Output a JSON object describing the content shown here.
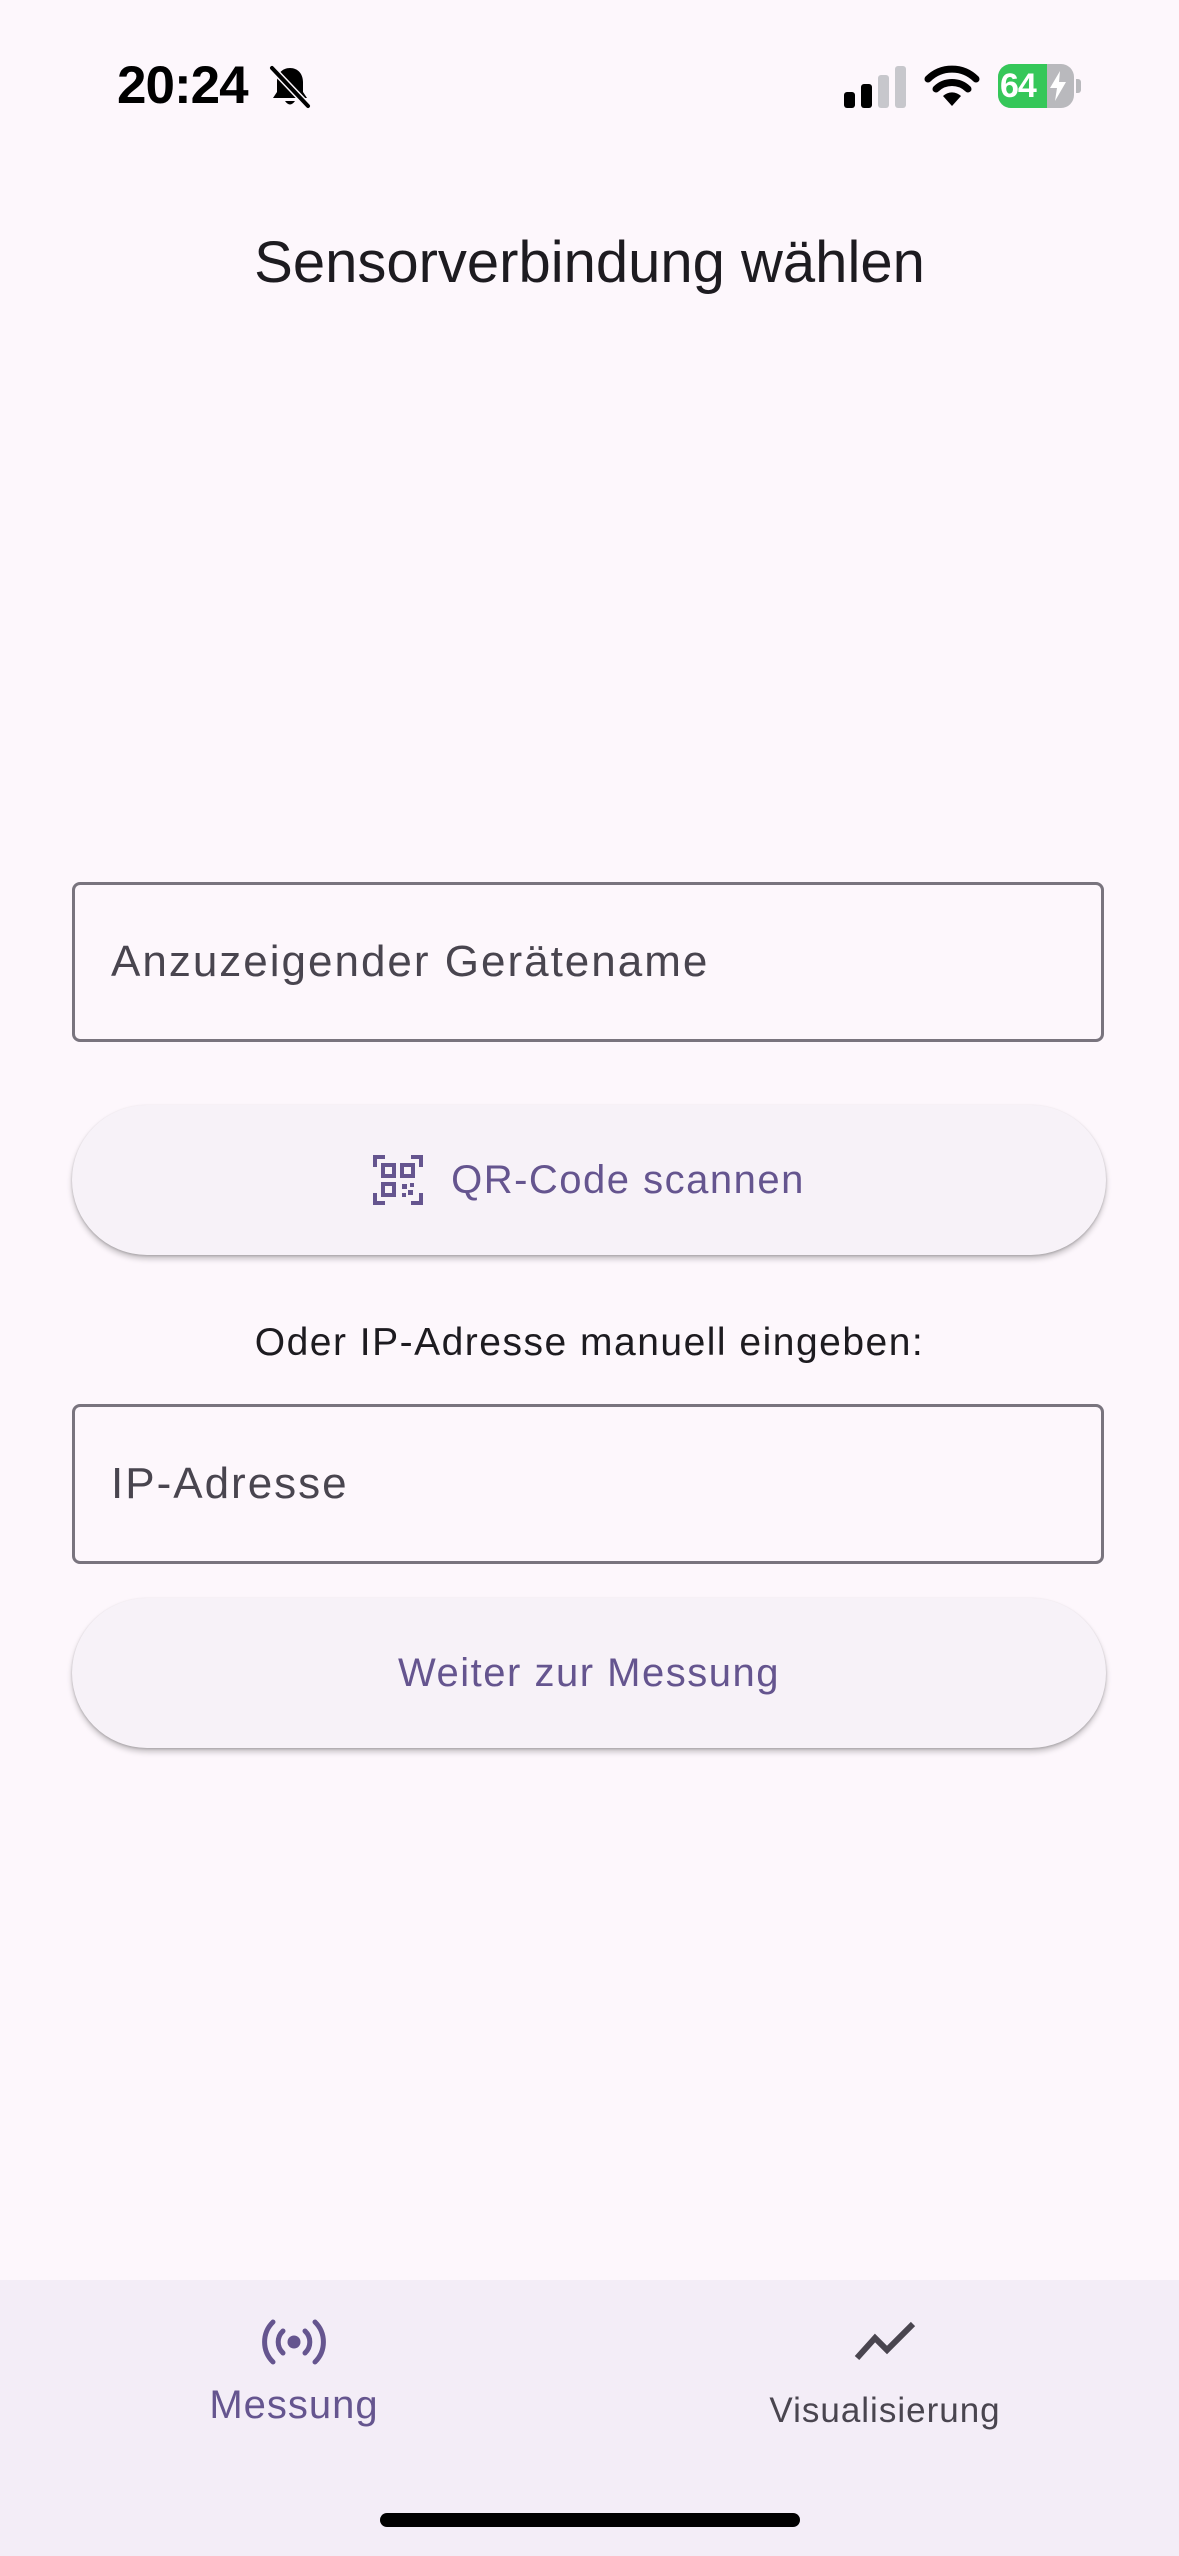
{
  "status_bar": {
    "time": "20:24",
    "battery_level": "64",
    "battery_fraction": 0.64,
    "icons": [
      "bell-slash-icon",
      "cellular-signal-icon",
      "wifi-icon",
      "battery-charging-icon"
    ]
  },
  "header": {
    "title": "Sensorverbindung wählen"
  },
  "form": {
    "device_name_placeholder": "Anzuzeigender Gerätename",
    "device_name_value": "",
    "qr_button_label": "QR-Code scannen",
    "qr_button_icon": "qr-code-scanner-icon",
    "or_text": "Oder IP-Adresse manuell eingeben:",
    "ip_placeholder": "IP-Adresse",
    "ip_value": "",
    "continue_button_label": "Weiter zur Messung"
  },
  "bottom_nav": {
    "items": [
      {
        "label": "Messung",
        "icon": "sensors-icon",
        "active": true
      },
      {
        "label": "Visualisierung",
        "icon": "show-chart-icon",
        "active": false
      }
    ]
  },
  "colors": {
    "background": "#fdf7fc",
    "accent": "#65558f",
    "button_background": "#f7f2f8",
    "nav_background": "#f3edf7",
    "outline": "#79747e",
    "battery_green": "#35c759"
  }
}
